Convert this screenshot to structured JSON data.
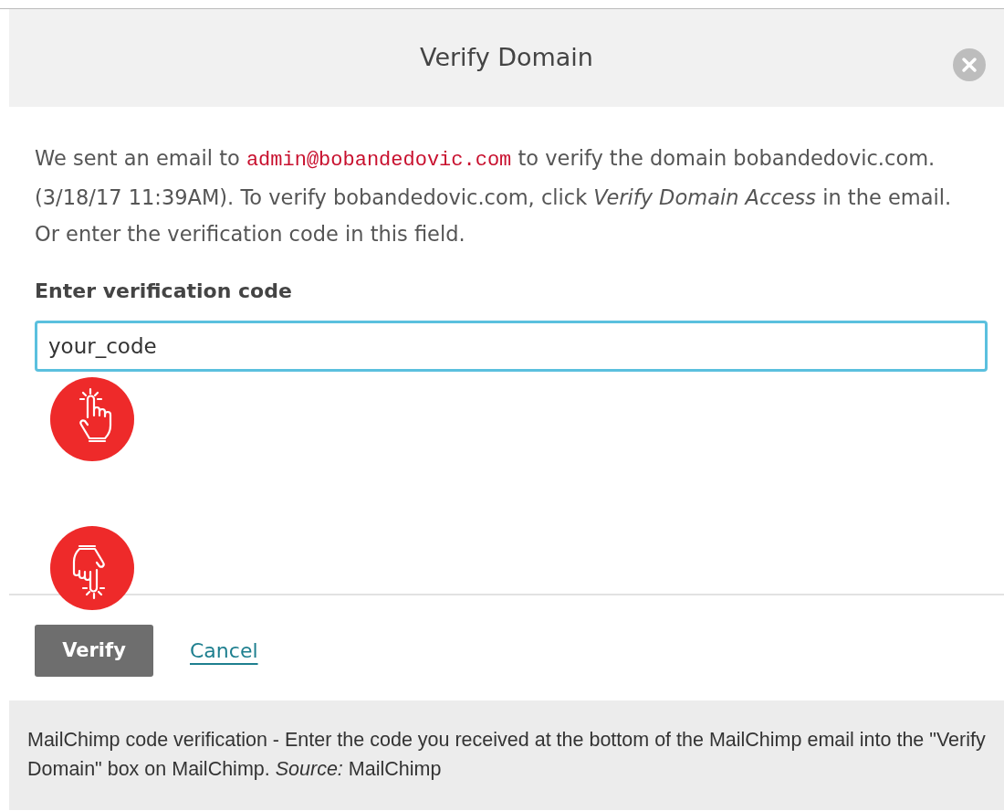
{
  "dialog": {
    "title": "Verify Domain",
    "message": [
      {
        "kind": "text",
        "text": "We sent an email to "
      },
      {
        "kind": "email",
        "text": "admin@bobandedovic.com"
      },
      {
        "kind": "text",
        "text": " to verify the domain bobandedovic.com. (3/18/17 11:39AM). To verify bobandedovic.com, click *Verify Domain Access* in the email. Or enter the verification code in this field."
      }
    ],
    "field": {
      "label": "Enter verification code",
      "value": "your_code"
    },
    "buttons": [
      {
        "kind": "primary",
        "label": "Verify"
      },
      {
        "kind": "link",
        "label": "Cancel"
      }
    ]
  },
  "caption": "MailChimp code verification - Enter the code you received at the bottom of the MailChimp email into the \"Verify Domain\" box on MailChimp. *Source:* MailChimp"
}
